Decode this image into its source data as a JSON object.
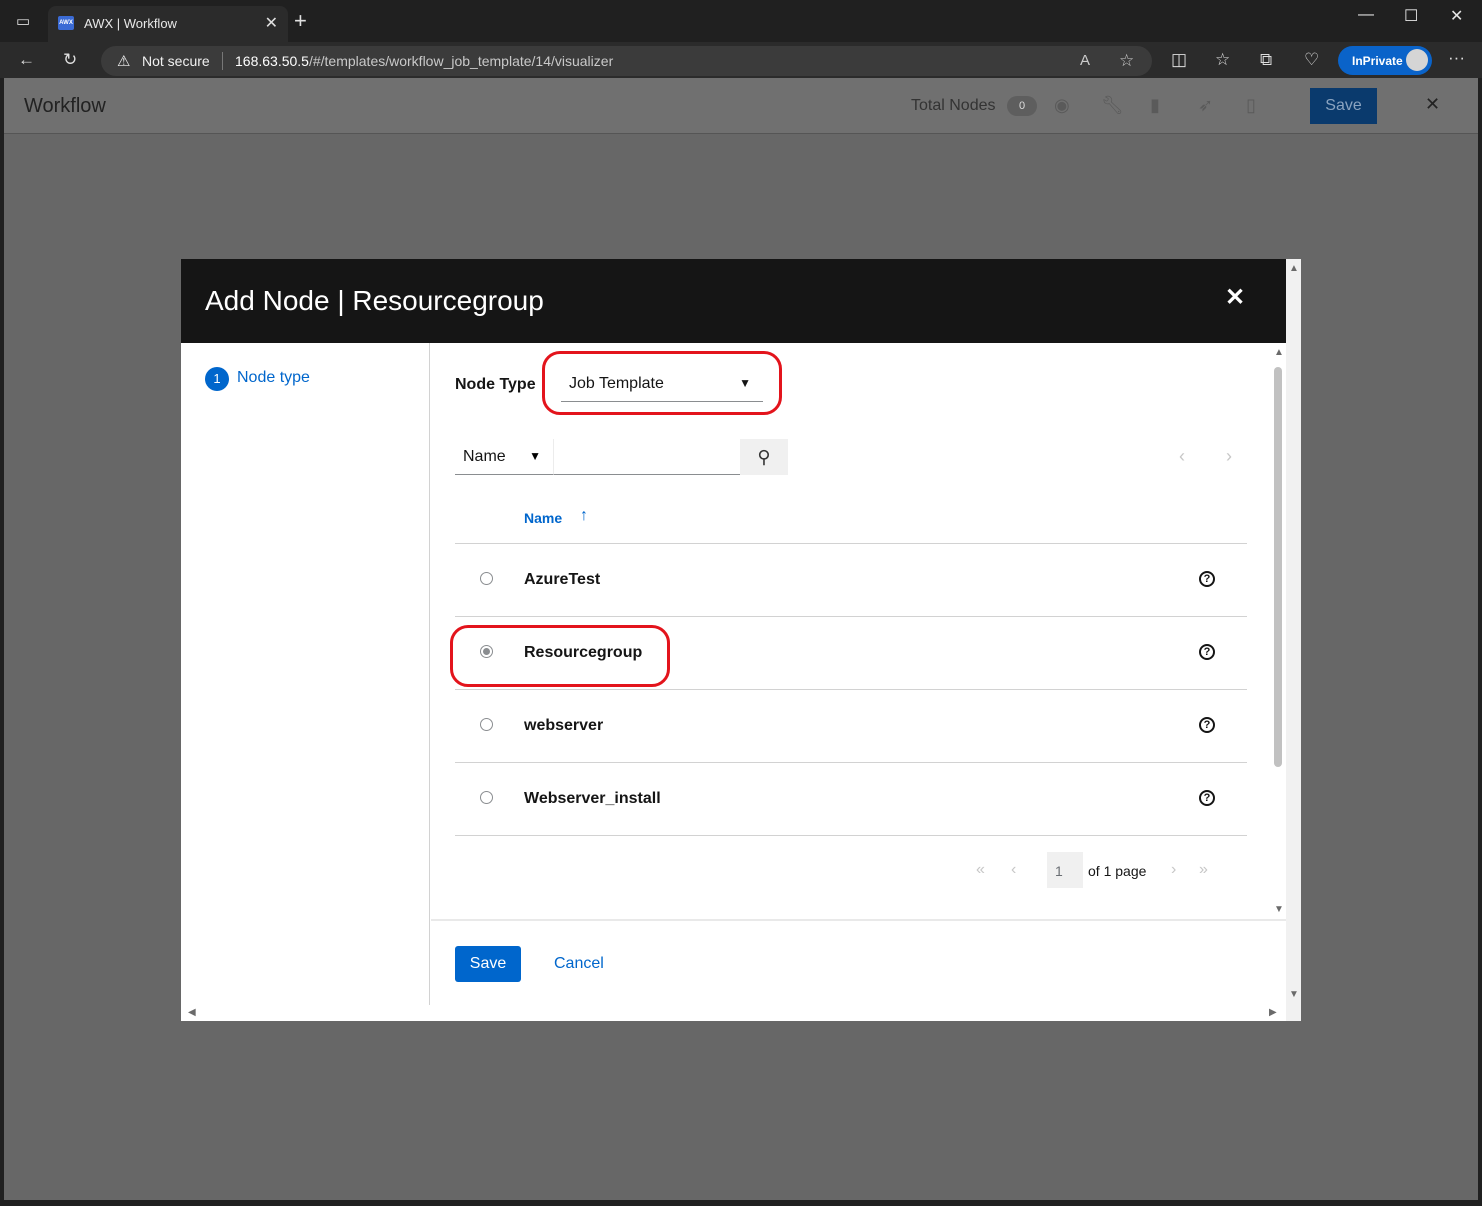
{
  "browser": {
    "tab_title": "AWX | Workflow",
    "tab_favicon": "AWX",
    "security_label": "Not secure",
    "url_host": "168.63.50.5",
    "url_path": "/#/templates/workflow_job_template/14/visualizer",
    "inprivate_label": "InPrivate"
  },
  "workflow": {
    "title": "Workflow",
    "total_nodes_label": "Total Nodes",
    "total_nodes_count": "0",
    "save_label": "Save"
  },
  "modal": {
    "title": "Add Node | Resourcegroup",
    "step": {
      "number": "1",
      "label": "Node type"
    },
    "node_type_label": "Node Type",
    "node_type_value": "Job Template",
    "filter_field": "Name",
    "filter_placeholder": "",
    "column_name": "Name",
    "rows": [
      {
        "name": "AzureTest",
        "selected": false
      },
      {
        "name": "Resourcegroup",
        "selected": true
      },
      {
        "name": "webserver",
        "selected": false
      },
      {
        "name": "Webserver_install",
        "selected": false
      }
    ],
    "pagination": {
      "page": "1",
      "of_label": "of 1 page"
    },
    "save_label": "Save",
    "cancel_label": "Cancel"
  },
  "colors": {
    "accent": "#0066cc",
    "highlight_annotation": "#e3141c",
    "modal_header": "#151515"
  }
}
